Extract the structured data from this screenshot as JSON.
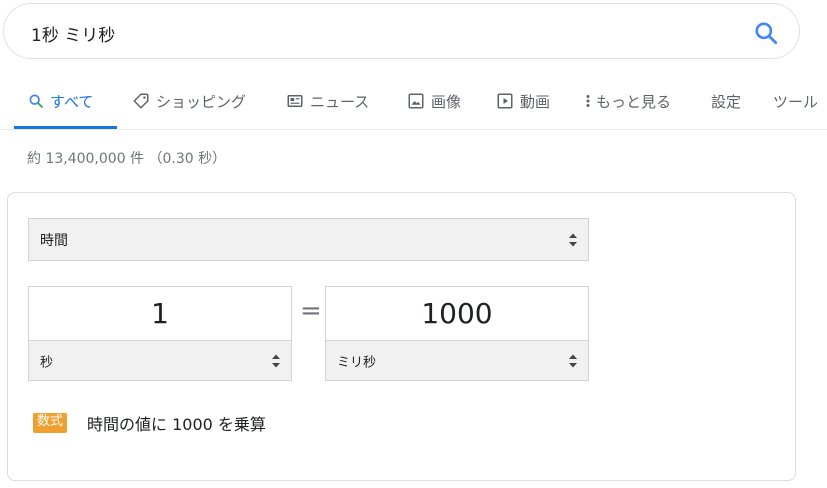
{
  "search": {
    "query": "1秒 ミリ秒"
  },
  "tabs": [
    {
      "label": "すべて",
      "icon": "search-icon",
      "active": true
    },
    {
      "label": "ショッピング",
      "icon": "tag-icon"
    },
    {
      "label": "ニュース",
      "icon": "news-icon"
    },
    {
      "label": "画像",
      "icon": "image-icon"
    },
    {
      "label": "動画",
      "icon": "video-icon"
    },
    {
      "label": "もっと見る",
      "icon": "more-vert-icon"
    },
    {
      "label": "設定"
    },
    {
      "label": "ツール"
    }
  ],
  "result_stats": "約 13,400,000 件 （0.30 秒）",
  "converter": {
    "category": "時間",
    "from": {
      "value": "1",
      "unit": "秒"
    },
    "to": {
      "value": "1000",
      "unit": "ミリ秒"
    },
    "equals": "=",
    "formula_badge": "数式",
    "formula_text": "時間の値に 1000 を乗算"
  },
  "colors": {
    "accent": "#1a73e8",
    "badge": "#f0a030",
    "muted": "#5f6368"
  }
}
